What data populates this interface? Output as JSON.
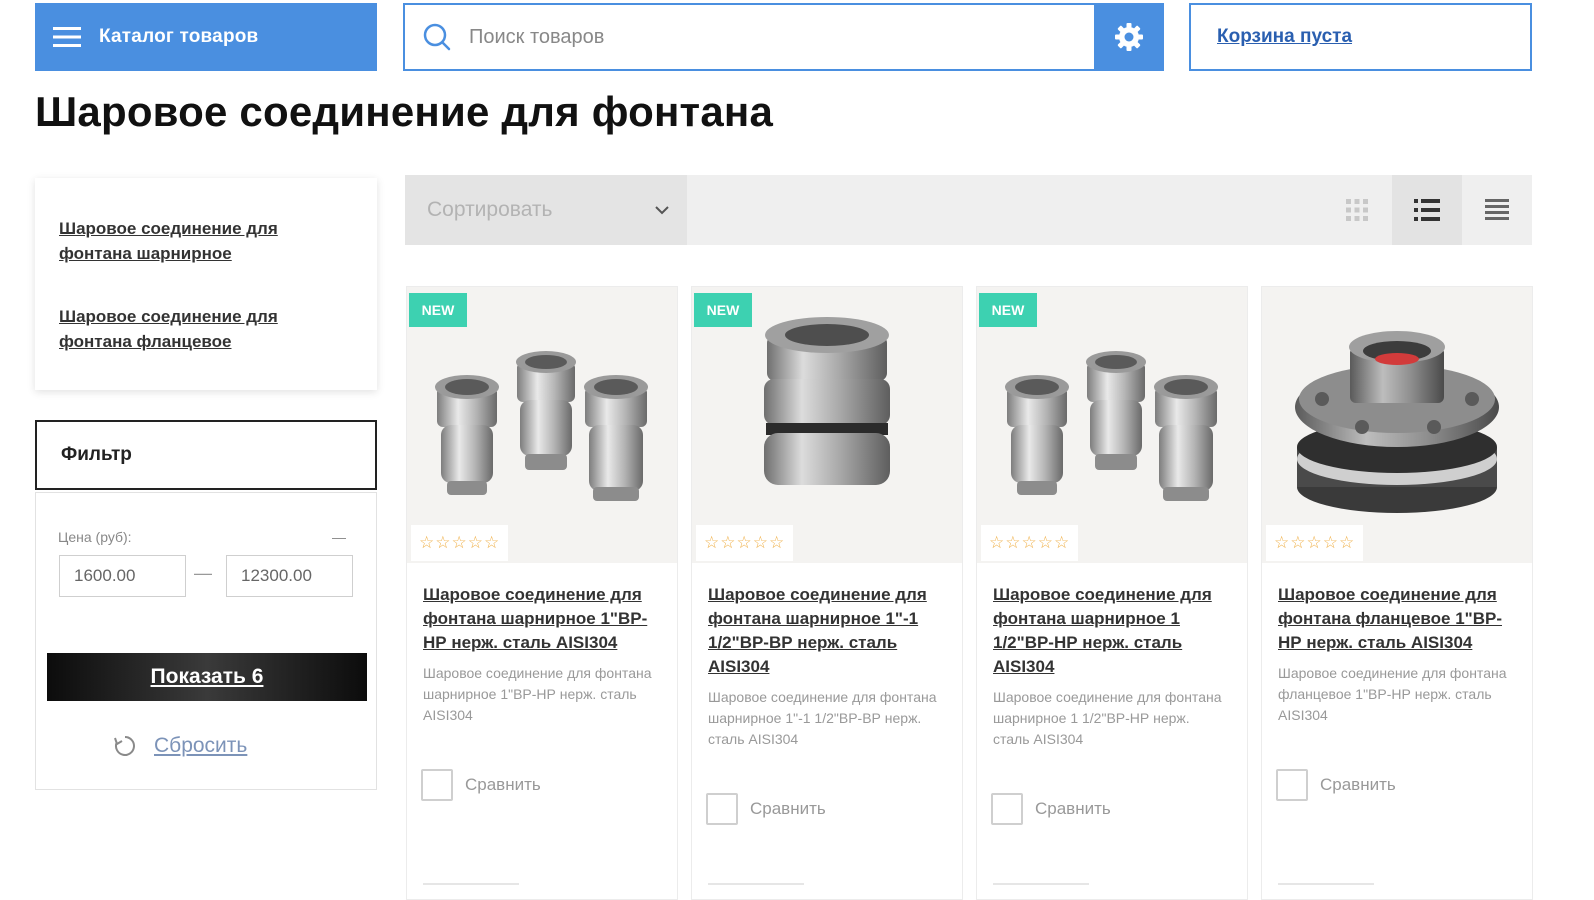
{
  "header": {
    "catalog_label": "Каталог товаров",
    "search_placeholder": "Поиск товаров",
    "cart_label": "Корзина пуста",
    "accent_color": "#4a8fe0"
  },
  "page": {
    "title": "Шаровое соединение для фонтана"
  },
  "sidebar": {
    "subcategories": [
      {
        "label": "Шаровое соединение для фонтана шарнирное"
      },
      {
        "label": "Шаровое соединение для фонтана фланцевое"
      }
    ],
    "filter": {
      "title": "Фильтр",
      "price_label": "Цена (руб):",
      "price_toggle": "—",
      "price_from": "1600.00",
      "price_to": "12300.00",
      "price_dash": "—",
      "show_button": "Показать 6",
      "reset_label": "Сбросить"
    }
  },
  "toolbar": {
    "sort_label": "Сортировать",
    "views": [
      "grid-view-icon",
      "list-view-icon",
      "table-view-icon"
    ],
    "active_view": "list"
  },
  "products": [
    {
      "badge": "NEW",
      "rating": 0,
      "stars": "☆☆☆☆☆",
      "title": "Шаровое соединение для фонтана шарнирное 1\"ВР-НР нерж. сталь AISI304",
      "description": "Шаровое соединение для фонтана шарнирное 1\"ВР-НР нерж. сталь AISI304",
      "compare_label": "Сравнить",
      "image": "three-steel-ball-joints"
    },
    {
      "badge": "NEW",
      "rating": 0,
      "stars": "☆☆☆☆☆",
      "title": "Шаровое соединение для фонтана шарнирное 1\"-1 1/2\"ВР-ВР нерж. сталь AISI304",
      "description": "Шаровое соединение для фонтана шарнирное 1\"-1 1/2\"ВР-ВР нерж. сталь AISI304",
      "compare_label": "Сравнить",
      "image": "single-steel-ball-joint"
    },
    {
      "badge": "NEW",
      "rating": 0,
      "stars": "☆☆☆☆☆",
      "title": "Шаровое соединение для фонтана шарнирное 1 1/2\"ВР-НР нерж. сталь AISI304",
      "description": "Шаровое соединение для фонтана шарнирное 1 1/2\"ВР-НР нерж. сталь AISI304",
      "compare_label": "Сравнить",
      "image": "three-steel-ball-joints"
    },
    {
      "badge": "",
      "rating": 0,
      "stars": "☆☆☆☆☆",
      "title": "Шаровое соединение для фонтана фланцевое 1\"ВР-НР нерж. сталь AISI304",
      "description": "Шаровое соединение для фонтана фланцевое 1\"ВР-НР нерж. сталь AISI304",
      "compare_label": "Сравнить",
      "image": "flanged-ball-joint"
    }
  ]
}
